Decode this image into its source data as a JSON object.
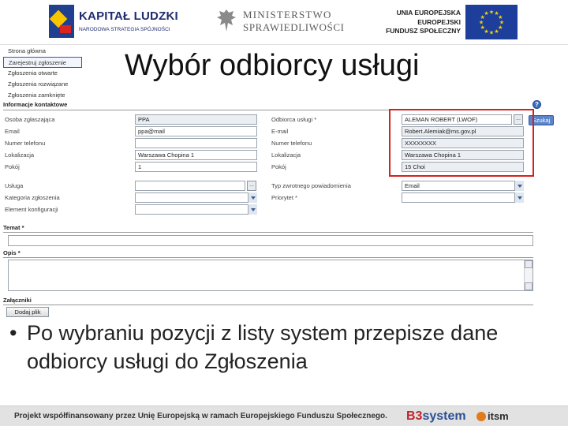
{
  "header": {
    "kl_title": "KAPITAŁ LUDZKI",
    "kl_sub": "NARODOWA STRATEGIA SPÓJNOŚCI",
    "ministry_line1": "MINISTERSTWO",
    "ministry_line2": "SPRAWIEDLIWOŚCI",
    "eu_line1": "UNIA EUROPEJSKA",
    "eu_line2": "EUROPEJSKI",
    "eu_line3": "FUNDUSZ SPOŁECZNY"
  },
  "nav": {
    "items": [
      "Strona główna",
      "Zarejestruj zgłoszenie",
      "Zgłoszenia otwarte",
      "Zgłoszenia rozwiązane",
      "Zgłoszenia zamknięte"
    ],
    "active_index": 1
  },
  "slide_title": "Wybór odbiorcy usługi",
  "form": {
    "section_contact": "Informacje kontaktowe",
    "left": [
      {
        "label": "Osoba zgłaszająca",
        "value": "PPA"
      },
      {
        "label": "Email",
        "value": "ppa@mail"
      },
      {
        "label": "Numer telefonu",
        "value": ""
      },
      {
        "label": "Lokalizacja",
        "value": "Warszawa Chopina 1"
      },
      {
        "label": "Pokój",
        "value": "1"
      },
      {
        "label": "Usługa",
        "value": ""
      },
      {
        "label": "Kategoria zgłoszenia",
        "value": ""
      },
      {
        "label": "Element konfiguracji",
        "value": ""
      }
    ],
    "right": [
      {
        "label": "Odbiorca usługi *",
        "value": "ALEMAN ROBERT (LWOF)"
      },
      {
        "label": "E-mail",
        "value": "Robert.Alemiak@ms.gov.pl"
      },
      {
        "label": "Numer telefonu",
        "value": "XXXXXXXX"
      },
      {
        "label": "Lokalizacja",
        "value": "Warszawa Chopina 1"
      },
      {
        "label": "Pokój",
        "value": "15 Choi"
      },
      {
        "label": "Typ zwrotnego powiadomienia",
        "value": "Email"
      },
      {
        "label": "Priorytet *",
        "value": ""
      }
    ],
    "search_button": "Szukaj",
    "help_icon_label": "?",
    "topic_label": "Temat *",
    "description_label": "Opis *",
    "attachments_label": "Załączniki",
    "attach_button": "Dodaj plik",
    "lookup_button": "..."
  },
  "bullet": {
    "dot": "•",
    "text": "Po wybraniu pozycji z listy system przepisze dane odbiorcy usługi do Zgłoszenia"
  },
  "footer": {
    "text": "Projekt współfinansowany przez Unię Europejską w ramach Europejskiego Funduszu Społecznego.",
    "b3_prefix": "B3",
    "b3_suffix": "system",
    "itsm": "itsm"
  },
  "colors": {
    "highlight_box": "#d42020",
    "nav_active_border": "#3a55a8",
    "eu_flag": "#1d3f9b",
    "stars": "#f7d300"
  }
}
